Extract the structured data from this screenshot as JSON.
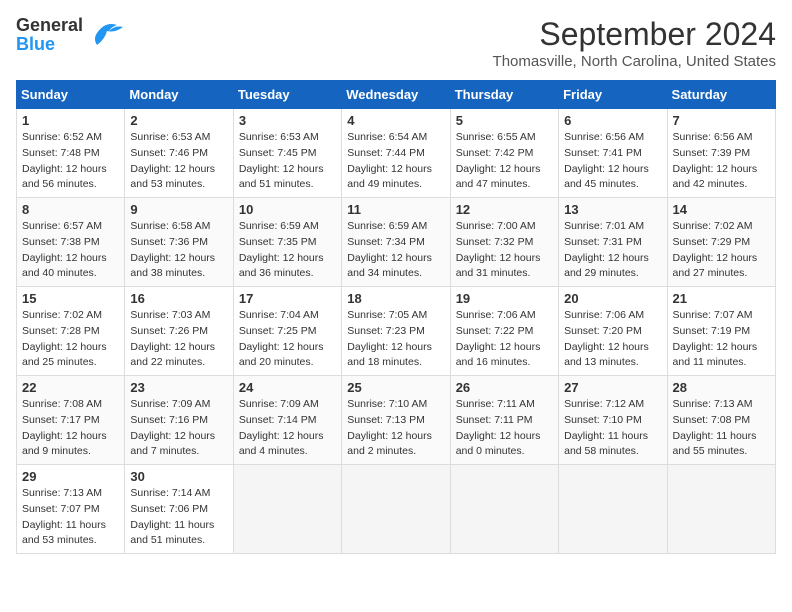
{
  "logo": {
    "line1": "General",
    "line2": "Blue"
  },
  "title": "September 2024",
  "subtitle": "Thomasville, North Carolina, United States",
  "days_of_week": [
    "Sunday",
    "Monday",
    "Tuesday",
    "Wednesday",
    "Thursday",
    "Friday",
    "Saturday"
  ],
  "weeks": [
    [
      {
        "day": "1",
        "sunrise": "6:52 AM",
        "sunset": "7:48 PM",
        "daylight": "12 hours and 56 minutes."
      },
      {
        "day": "2",
        "sunrise": "6:53 AM",
        "sunset": "7:46 PM",
        "daylight": "12 hours and 53 minutes."
      },
      {
        "day": "3",
        "sunrise": "6:53 AM",
        "sunset": "7:45 PM",
        "daylight": "12 hours and 51 minutes."
      },
      {
        "day": "4",
        "sunrise": "6:54 AM",
        "sunset": "7:44 PM",
        "daylight": "12 hours and 49 minutes."
      },
      {
        "day": "5",
        "sunrise": "6:55 AM",
        "sunset": "7:42 PM",
        "daylight": "12 hours and 47 minutes."
      },
      {
        "day": "6",
        "sunrise": "6:56 AM",
        "sunset": "7:41 PM",
        "daylight": "12 hours and 45 minutes."
      },
      {
        "day": "7",
        "sunrise": "6:56 AM",
        "sunset": "7:39 PM",
        "daylight": "12 hours and 42 minutes."
      }
    ],
    [
      {
        "day": "8",
        "sunrise": "6:57 AM",
        "sunset": "7:38 PM",
        "daylight": "12 hours and 40 minutes."
      },
      {
        "day": "9",
        "sunrise": "6:58 AM",
        "sunset": "7:36 PM",
        "daylight": "12 hours and 38 minutes."
      },
      {
        "day": "10",
        "sunrise": "6:59 AM",
        "sunset": "7:35 PM",
        "daylight": "12 hours and 36 minutes."
      },
      {
        "day": "11",
        "sunrise": "6:59 AM",
        "sunset": "7:34 PM",
        "daylight": "12 hours and 34 minutes."
      },
      {
        "day": "12",
        "sunrise": "7:00 AM",
        "sunset": "7:32 PM",
        "daylight": "12 hours and 31 minutes."
      },
      {
        "day": "13",
        "sunrise": "7:01 AM",
        "sunset": "7:31 PM",
        "daylight": "12 hours and 29 minutes."
      },
      {
        "day": "14",
        "sunrise": "7:02 AM",
        "sunset": "7:29 PM",
        "daylight": "12 hours and 27 minutes."
      }
    ],
    [
      {
        "day": "15",
        "sunrise": "7:02 AM",
        "sunset": "7:28 PM",
        "daylight": "12 hours and 25 minutes."
      },
      {
        "day": "16",
        "sunrise": "7:03 AM",
        "sunset": "7:26 PM",
        "daylight": "12 hours and 22 minutes."
      },
      {
        "day": "17",
        "sunrise": "7:04 AM",
        "sunset": "7:25 PM",
        "daylight": "12 hours and 20 minutes."
      },
      {
        "day": "18",
        "sunrise": "7:05 AM",
        "sunset": "7:23 PM",
        "daylight": "12 hours and 18 minutes."
      },
      {
        "day": "19",
        "sunrise": "7:06 AM",
        "sunset": "7:22 PM",
        "daylight": "12 hours and 16 minutes."
      },
      {
        "day": "20",
        "sunrise": "7:06 AM",
        "sunset": "7:20 PM",
        "daylight": "12 hours and 13 minutes."
      },
      {
        "day": "21",
        "sunrise": "7:07 AM",
        "sunset": "7:19 PM",
        "daylight": "12 hours and 11 minutes."
      }
    ],
    [
      {
        "day": "22",
        "sunrise": "7:08 AM",
        "sunset": "7:17 PM",
        "daylight": "12 hours and 9 minutes."
      },
      {
        "day": "23",
        "sunrise": "7:09 AM",
        "sunset": "7:16 PM",
        "daylight": "12 hours and 7 minutes."
      },
      {
        "day": "24",
        "sunrise": "7:09 AM",
        "sunset": "7:14 PM",
        "daylight": "12 hours and 4 minutes."
      },
      {
        "day": "25",
        "sunrise": "7:10 AM",
        "sunset": "7:13 PM",
        "daylight": "12 hours and 2 minutes."
      },
      {
        "day": "26",
        "sunrise": "7:11 AM",
        "sunset": "7:11 PM",
        "daylight": "12 hours and 0 minutes."
      },
      {
        "day": "27",
        "sunrise": "7:12 AM",
        "sunset": "7:10 PM",
        "daylight": "11 hours and 58 minutes."
      },
      {
        "day": "28",
        "sunrise": "7:13 AM",
        "sunset": "7:08 PM",
        "daylight": "11 hours and 55 minutes."
      }
    ],
    [
      {
        "day": "29",
        "sunrise": "7:13 AM",
        "sunset": "7:07 PM",
        "daylight": "11 hours and 53 minutes."
      },
      {
        "day": "30",
        "sunrise": "7:14 AM",
        "sunset": "7:06 PM",
        "daylight": "11 hours and 51 minutes."
      },
      null,
      null,
      null,
      null,
      null
    ]
  ]
}
